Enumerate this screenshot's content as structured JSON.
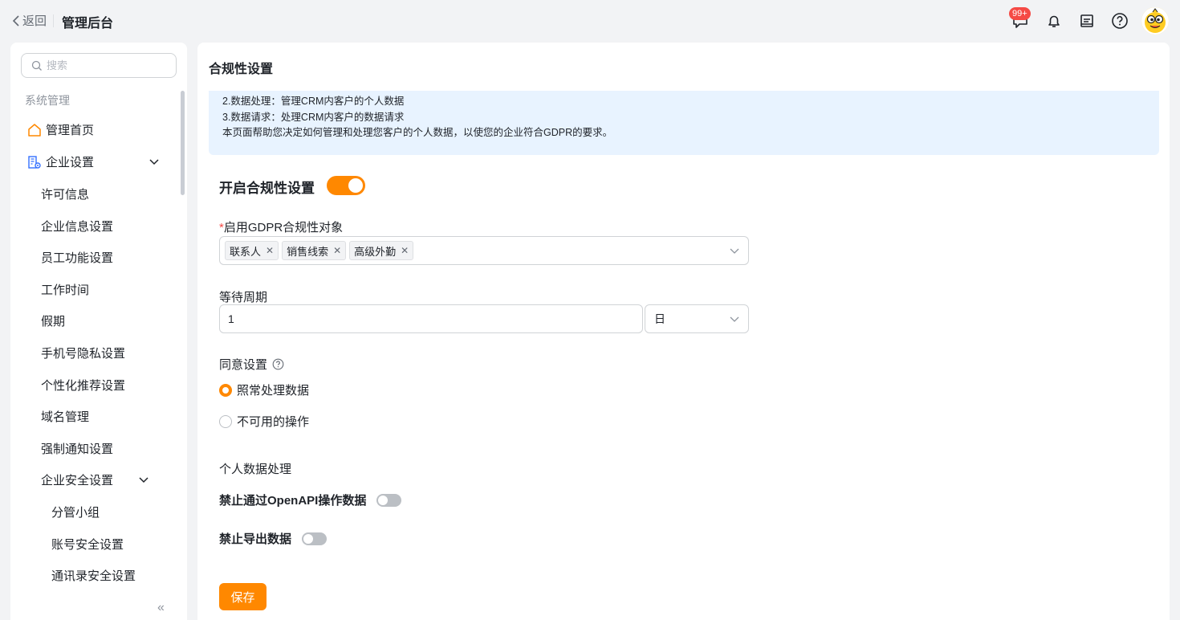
{
  "header": {
    "back_label": "返回",
    "title": "管理后台",
    "message_badge": "99+",
    "icons": [
      "chat-icon",
      "bell-icon",
      "notebook-icon",
      "help-icon"
    ]
  },
  "sidebar": {
    "search_placeholder": "搜索",
    "section_label": "系统管理",
    "items": [
      {
        "label": "管理首页",
        "icon": "home-icon"
      },
      {
        "label": "企业设置",
        "icon": "company-settings-icon",
        "expanded": true
      },
      {
        "label": "许可信息"
      },
      {
        "label": "企业信息设置"
      },
      {
        "label": "员工功能设置"
      },
      {
        "label": "工作时间"
      },
      {
        "label": "假期"
      },
      {
        "label": "手机号隐私设置"
      },
      {
        "label": "个性化推荐设置"
      },
      {
        "label": "域名管理"
      },
      {
        "label": "强制通知设置"
      },
      {
        "label": "企业安全设置",
        "expanded": true
      },
      {
        "label": "分管小组"
      },
      {
        "label": "账号安全设置"
      },
      {
        "label": "通讯录安全设置"
      }
    ],
    "collapse_label": "«"
  },
  "main": {
    "title": "合规性设置",
    "info_lines": [
      "2.数据处理：管理CRM内客户的个人数据",
      "3.数据请求：处理CRM内客户的数据请求",
      "本页面帮助您决定如何管理和处理您客户的个人数据，以使您的企业符合GDPR的要求。"
    ],
    "enable_label": "开启合规性设置",
    "enable_on": true,
    "gdpr_required_mark": "*",
    "gdpr_label": "启用GDPR合规性对象",
    "gdpr_tags": [
      "联系人",
      "销售线索",
      "高级外勤"
    ],
    "wait_label": "等待周期",
    "wait_value": "1",
    "wait_unit": "日",
    "consent_label": "同意设置",
    "consent_options": [
      {
        "label": "照常处理数据",
        "selected": true
      },
      {
        "label": "不可用的操作",
        "selected": false
      }
    ],
    "personal_label": "个人数据处理",
    "toggles": [
      {
        "label": "禁止通过OpenAPI操作数据",
        "on": false
      },
      {
        "label": "禁止导出数据",
        "on": false
      }
    ],
    "save_label": "保存",
    "accent_color": "#ff8800"
  }
}
